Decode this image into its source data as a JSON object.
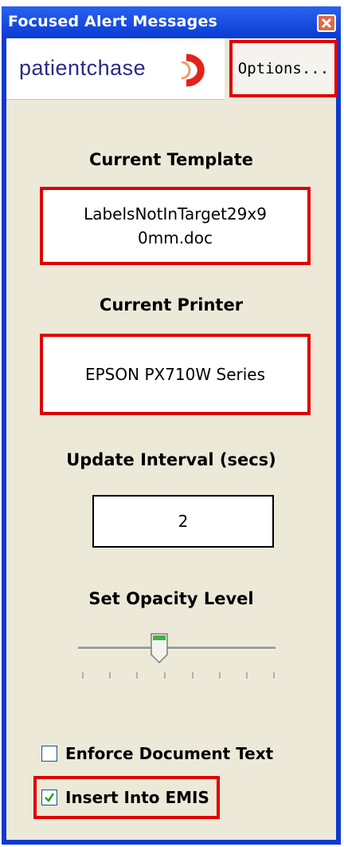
{
  "window": {
    "title": "Focused Alert Messages"
  },
  "logo": {
    "brand_text": "patientchase"
  },
  "options": {
    "label": "Options..."
  },
  "template": {
    "heading": "Current Template",
    "value": "LabelsNotInTarget29x90mm.doc"
  },
  "printer": {
    "heading": "Current Printer",
    "value": "EPSON PX710W Series"
  },
  "interval": {
    "heading": "Update Interval (secs)",
    "value": "2"
  },
  "opacity": {
    "heading": "Set Opacity Level",
    "level_fraction": 0.4
  },
  "checkboxes": {
    "enforce": {
      "label": "Enforce Document Text",
      "checked": false
    },
    "emis": {
      "label": "Insert Into EMIS",
      "checked": true
    }
  },
  "colors": {
    "titlebar": "#0a3bd0",
    "highlight": "#e00000",
    "panel": "#ece9d8",
    "logo_accent": "#e2231a"
  }
}
